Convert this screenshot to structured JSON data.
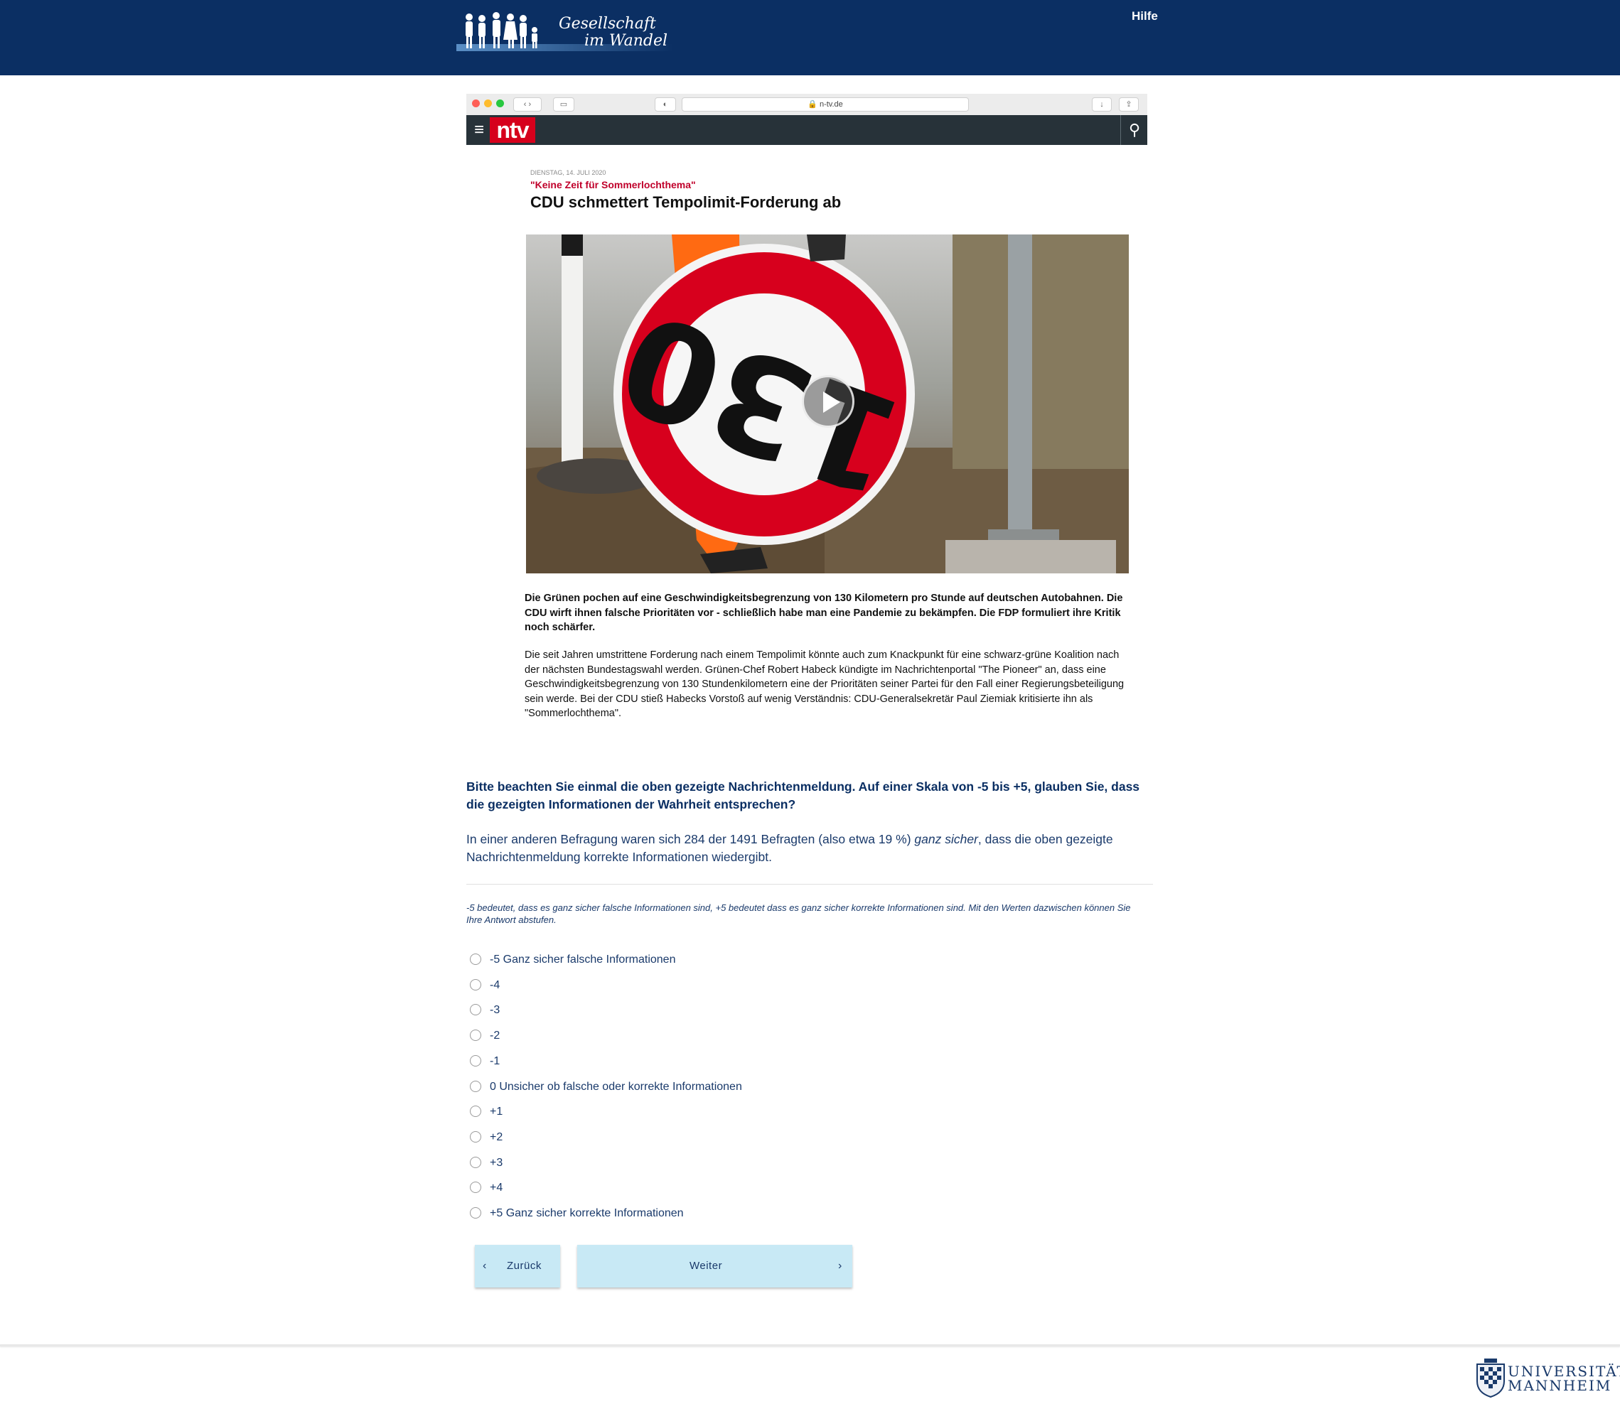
{
  "header": {
    "logo_line1": "Gesellschaft",
    "logo_line2": "im Wandel",
    "help_label": "Hilfe"
  },
  "article_screenshot": {
    "browser_url": "n-tv.de",
    "site_logo": "ntv",
    "date": "DIENSTAG, 14. JULI 2020",
    "kicker": "\"Keine Zeit für Sommerlochthema\"",
    "headline": "CDU schmettert Tempolimit-Forderung ab",
    "sign_number": "130",
    "lead": "Die Grünen pochen auf eine Geschwindigkeitsbegrenzung von 130 Kilometern pro Stunde auf deutschen Autobahnen. Die CDU wirft ihnen falsche Prioritäten vor - schließlich habe man eine Pandemie zu bekämpfen. Die FDP formuliert ihre Kritik noch schärfer.",
    "body": "Die seit Jahren umstrittene Forderung nach einem Tempolimit könnte auch zum Knackpunkt für eine schwarz-grüne Koalition nach der nächsten Bundestagswahl werden. Grünen-Chef Robert Habeck kündigte im Nachrichtenportal \"The Pioneer\" an, dass eine Geschwindigkeitsbegrenzung von 130 Stundenkilometern eine der Prioritäten seiner Partei für den Fall einer Regierungsbeteiligung sein werde. Bei der CDU stieß Habecks Vorstoß auf wenig Verständnis: CDU-Generalsekretär Paul Ziemiak kritisierte ihn als \"Sommerlochthema\"."
  },
  "survey": {
    "question": "Bitte beachten Sie einmal die oben gezeigte Nachrichtenmeldung. Auf einer Skala von -5 bis +5, glauben Sie, dass die gezeigten Informationen der Wahrheit entsprechen?",
    "info_before": "In einer anderen Befragung waren sich 284 der 1491 Befragten (also etwa 19 %) ",
    "info_emph": "ganz sicher",
    "info_after": ", dass die oben gezeigte Nachrichtenmeldung korrekte Informationen wiedergibt.",
    "hint": "-5 bedeutet, dass es ganz sicher falsche Informationen sind, +5 bedeutet dass es ganz sicher korrekte Informationen sind. Mit den Werten dazwischen können Sie Ihre Antwort abstufen.",
    "options": [
      "-5 Ganz sicher falsche Informationen",
      "-4",
      "-3",
      "-2",
      "-1",
      "0 Unsicher ob falsche oder korrekte Informationen",
      "+1",
      "+2",
      "+3",
      "+4",
      "+5 Ganz sicher korrekte Informationen"
    ],
    "selected": null
  },
  "nav": {
    "back_label": "Zurück",
    "next_label": "Weiter"
  },
  "footer": {
    "university_line1": "UNIVERSITÄT",
    "university_line2": "MANNHEIM"
  },
  "colors": {
    "header_bg": "#0b2f63",
    "text_primary": "#1a3a6b",
    "button_bg": "#c8e9f5",
    "ntv_red": "#d6001c",
    "kicker_red": "#c0002b"
  }
}
